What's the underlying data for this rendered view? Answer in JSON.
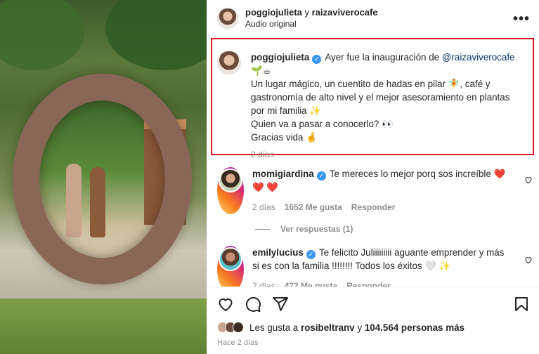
{
  "header": {
    "user1": "poggiojulieta",
    "conjunction": "y",
    "user2": "raizaviverocafe",
    "audio": "Audio original",
    "more_icon": "more-horizontal-icon"
  },
  "caption": {
    "username": "poggiojulieta",
    "line1_prefix": "Ayer fue la inauguración de",
    "mention": "@raizaviverocafe",
    "line1_emojis": "🌱☕",
    "line2": "Un lugar mágico, un cuentito de hadas en pilar 🧚, café y gastronomía de alto nivel y el mejor asesoramiento en plantas por mi familia ✨",
    "line3": "Quien va a pasar a conocerlo? 👀",
    "line4": "Gracias vida 🤞",
    "time": "2 días"
  },
  "comments": [
    {
      "username": "momigiardina",
      "text": "Te mereces lo mejor porq sos increíble ❤️❤️ ❤️",
      "time": "2 días",
      "likes": "1652 Me gusta",
      "reply": "Responder"
    },
    {
      "username": "emilylucius",
      "text": "Te felicito Juliiiiiiiii aguante emprender y más si es con la familia !!!!!!!! Todos los éxitos 🤍 ✨",
      "time": "2 días",
      "likes": "472 Me gusta",
      "reply": "Responder"
    }
  ],
  "view_replies": "Ver respuestas (1)",
  "likes": {
    "prefix": "Les gusta a",
    "user": "rosibeltranv",
    "conjunction": "y",
    "count": "104.564 personas más"
  },
  "timeago": "Hace 2 días",
  "colors": {
    "highlight_border": "#e2141f",
    "verified": "#3897f0",
    "mention": "#00376b"
  }
}
